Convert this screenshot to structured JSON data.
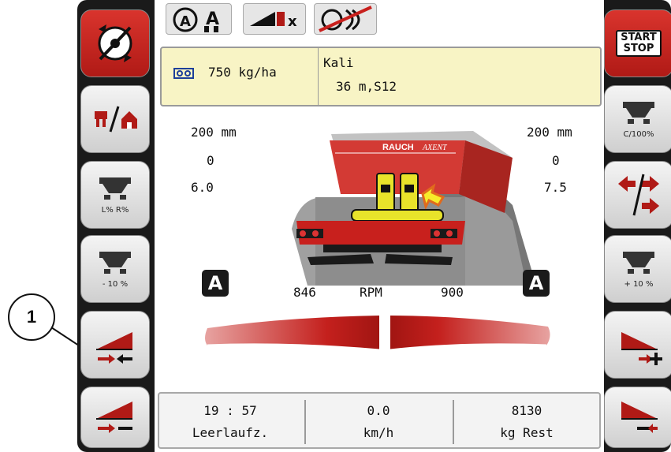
{
  "top_icons": [
    "auto-mode-a-icon",
    "spreader-x-icon",
    "disabled-sensor-icon"
  ],
  "left_buttons": [
    {
      "icon": "rotate-spreader-icon",
      "sub": ""
    },
    {
      "icon": "field-home-icon",
      "sub": ""
    },
    {
      "icon": "spreader-lr-icon",
      "sub": "L% R%"
    },
    {
      "icon": "spreader-minus-icon",
      "sub": "- 10 %"
    },
    {
      "icon": "boundary-left-in-icon",
      "sub": ""
    },
    {
      "icon": "boundary-left-out-icon",
      "sub": ""
    }
  ],
  "right_buttons": [
    {
      "label_line1": "START",
      "label_line2": "STOP"
    },
    {
      "icon": "spreader-reset-icon",
      "sub": "C/100%"
    },
    {
      "icon": "left-right-arrows-icon",
      "sub": ""
    },
    {
      "icon": "spreader-plus-icon",
      "sub": "+ 10 %"
    },
    {
      "icon": "boundary-right-in-icon",
      "sub": ""
    },
    {
      "icon": "boundary-right-out-icon",
      "sub": ""
    }
  ],
  "info": {
    "rate": "750 kg/ha",
    "fertilizer": "Kali",
    "width_disc": "36 m,S12"
  },
  "left_values": {
    "mm": "200 mm",
    "val2": "0",
    "val3": "6.0"
  },
  "right_values": {
    "mm": "200 mm",
    "val2": "0",
    "val3": "7.5"
  },
  "machine": {
    "brand": "RAUCH",
    "model": "AXENT"
  },
  "rpm": {
    "left": "846",
    "label": "RPM",
    "right": "900",
    "mode_left": "A",
    "mode_right": "A"
  },
  "status": [
    {
      "value": "19 : 57",
      "label": "Leerlaufz."
    },
    {
      "value": "0.0",
      "label": "km/h"
    },
    {
      "value": "8130",
      "label": "kg Rest"
    }
  ],
  "callout": "1",
  "colors": {
    "accent_red": "#c8201d",
    "info_bg": "#f8f4c5",
    "yellow": "#e8e32a"
  }
}
